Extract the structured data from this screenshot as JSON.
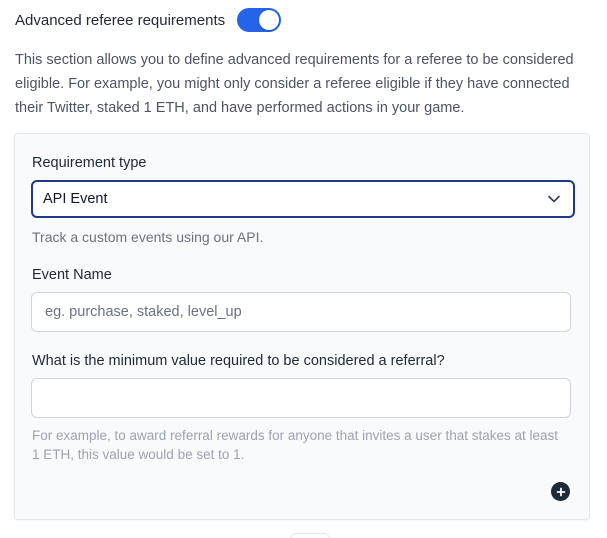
{
  "header": {
    "title": "Advanced referee requirements",
    "toggle_on": true
  },
  "description": "This section allows you to define advanced requirements for a referee to be considered eligible. For example, you might only consider a referee eligible if they have connected their Twitter, staked 1 ETH, and have performed actions in your game.",
  "requirement": {
    "type_label": "Requirement type",
    "type_value": "API Event",
    "type_help": "Track a custom events using our API.",
    "event_name_label": "Event Name",
    "event_name_placeholder": "eg. purchase, staked, level_up",
    "event_name_value": "",
    "min_value_label": "What is the minimum value required to be considered a referral?",
    "min_value_value": "",
    "min_value_help": "For example, to award referral rewards for anyone that invites a user that stakes at least 1 ETH, this value would be set to 1."
  },
  "icons": {
    "chevron": "chevron-down-icon",
    "add": "plus-circle-icon"
  },
  "colors": {
    "accent": "#2563eb",
    "select_border": "#1e3a8a",
    "add_button": "#1f2937"
  }
}
